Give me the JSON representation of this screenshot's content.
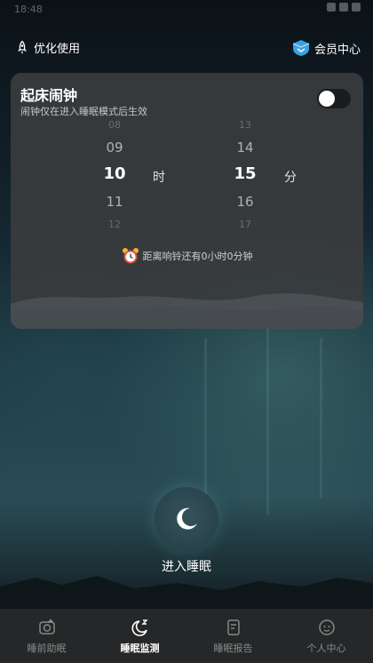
{
  "status_bar": {
    "time": "18:48"
  },
  "header": {
    "optimize_label": "优化使用",
    "vip_label": "会员中心"
  },
  "alarm_card": {
    "title": "起床闹钟",
    "subtitle": "闹钟仅在进入睡眠模式后生效",
    "toggle_on": false,
    "hour_picker": {
      "far_prev": "08",
      "prev": "09",
      "selected": "10",
      "next": "11",
      "far_next": "12"
    },
    "hour_unit": "时",
    "minute_picker": {
      "far_prev": "13",
      "prev": "14",
      "selected": "15",
      "next": "16",
      "far_next": "17"
    },
    "minute_unit": "分",
    "countdown_text": "距离响铃还有0小时0分钟"
  },
  "main": {
    "enter_sleep_label": "进入睡眠"
  },
  "tabs": [
    {
      "label": "睡前助眠",
      "icon": "camera-icon",
      "active": false
    },
    {
      "label": "睡眠监测",
      "icon": "moon-zz-icon",
      "active": true
    },
    {
      "label": "睡眠报告",
      "icon": "report-icon",
      "active": false
    },
    {
      "label": "个人中心",
      "icon": "face-icon",
      "active": false
    }
  ],
  "colors": {
    "card_bg": "#3a3c3e",
    "tabbar_bg": "#262728",
    "vip_blue": "#3ba0e6"
  }
}
